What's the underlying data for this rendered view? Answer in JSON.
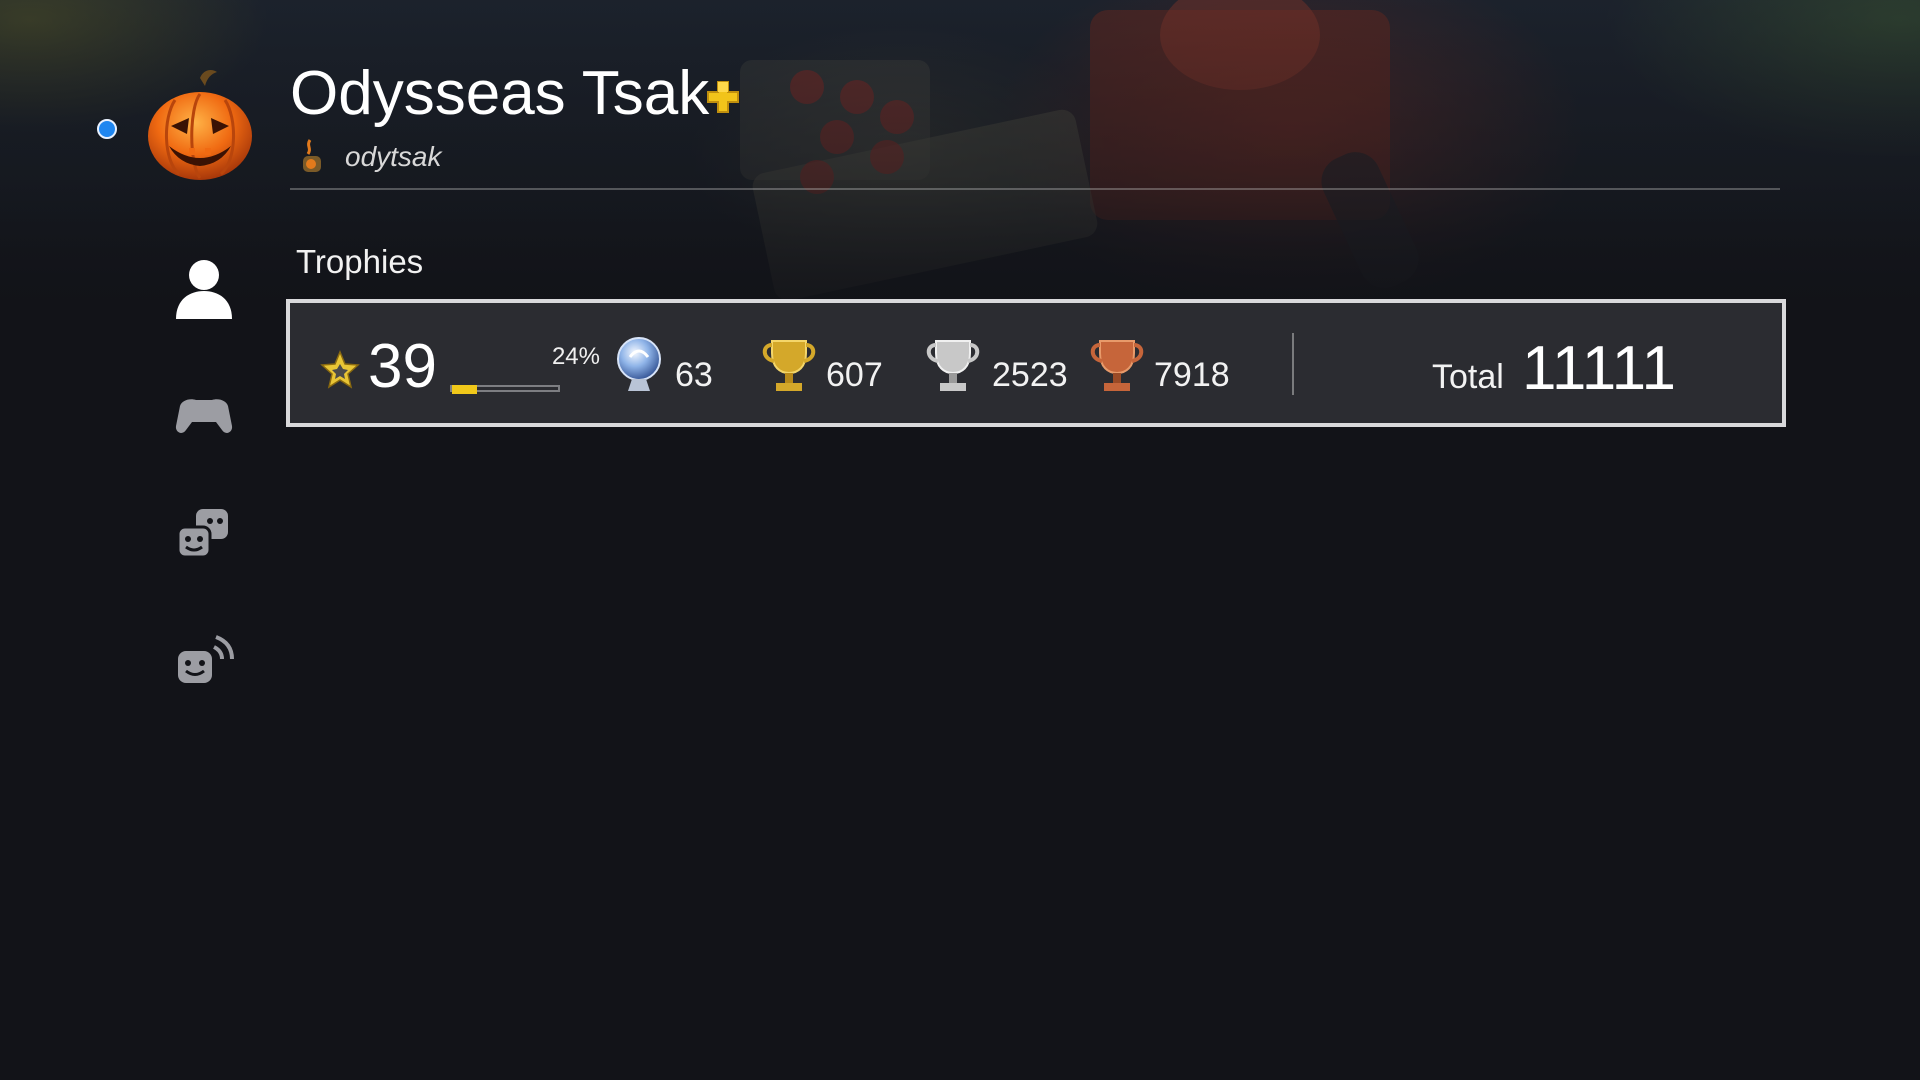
{
  "profile": {
    "name": "Odysseas Tsak",
    "online_id": "odytsak",
    "online_status_color": "#1f86f0",
    "avatar_icon": "jack-o-lantern-avatar",
    "plus_icon": "playstation-plus-icon",
    "plus_color": "#f2c41a"
  },
  "sidebar": {
    "items": [
      {
        "icon": "profile-icon",
        "selected": true
      },
      {
        "icon": "gamepad-icon",
        "selected": false
      },
      {
        "icon": "friends-icon",
        "selected": false
      },
      {
        "icon": "activity-icon",
        "selected": false
      }
    ]
  },
  "trophies": {
    "section_title": "Trophies",
    "level": "39",
    "level_progress_label": "24%",
    "level_progress": 0.24,
    "platinum": "63",
    "gold": "607",
    "silver": "2523",
    "bronze": "7918",
    "total_label": "Total",
    "total": "11111",
    "colors": {
      "progress": "#f0c81a",
      "platinum": "#8fb4e8",
      "gold": "#d4a82a",
      "silver": "#c8c8c8",
      "bronze": "#c6653a"
    }
  }
}
